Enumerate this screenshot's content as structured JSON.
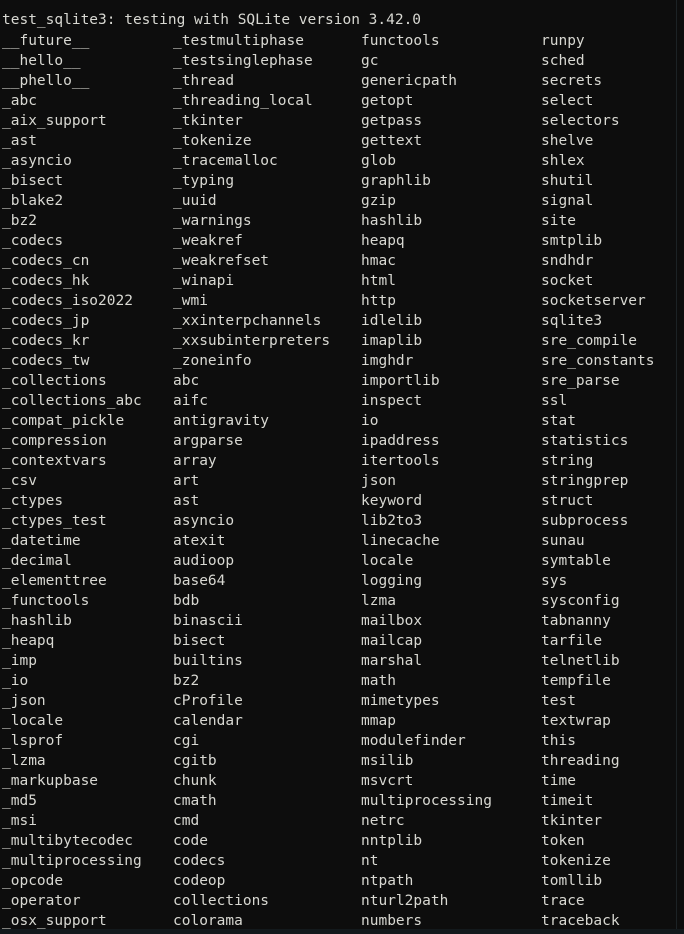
{
  "terminal": {
    "header_line": "test_sqlite3: testing with SQLite version 3.42.0",
    "background_color": "#0d0d0d",
    "text_color": "#d8d8d2",
    "divider_color": "#1c2225",
    "bottom_bar_color": "#13191c"
  },
  "module_columns": [
    {
      "name": "column-1",
      "items": [
        "__future__",
        "__hello__",
        "__phello__",
        "_abc",
        "_aix_support",
        "_ast",
        "_asyncio",
        "_bisect",
        "_blake2",
        "_bz2",
        "_codecs",
        "_codecs_cn",
        "_codecs_hk",
        "_codecs_iso2022",
        "_codecs_jp",
        "_codecs_kr",
        "_codecs_tw",
        "_collections",
        "_collections_abc",
        "_compat_pickle",
        "_compression",
        "_contextvars",
        "_csv",
        "_ctypes",
        "_ctypes_test",
        "_datetime",
        "_decimal",
        "_elementtree",
        "_functools",
        "_hashlib",
        "_heapq",
        "_imp",
        "_io",
        "_json",
        "_locale",
        "_lsprof",
        "_lzma",
        "_markupbase",
        "_md5",
        "_msi",
        "_multibytecodec",
        "_multiprocessing",
        "_opcode",
        "_operator",
        "_osx_support"
      ]
    },
    {
      "name": "column-2",
      "items": [
        "_testmultiphase",
        "_testsinglephase",
        "_thread",
        "_threading_local",
        "_tkinter",
        "_tokenize",
        "_tracemalloc",
        "_typing",
        "_uuid",
        "_warnings",
        "_weakref",
        "_weakrefset",
        "_winapi",
        "_wmi",
        "_xxinterpchannels",
        "_xxsubinterpreters",
        "_zoneinfo",
        "abc",
        "aifc",
        "antigravity",
        "argparse",
        "array",
        "art",
        "ast",
        "asyncio",
        "atexit",
        "audioop",
        "base64",
        "bdb",
        "binascii",
        "bisect",
        "builtins",
        "bz2",
        "cProfile",
        "calendar",
        "cgi",
        "cgitb",
        "chunk",
        "cmath",
        "cmd",
        "code",
        "codecs",
        "codeop",
        "collections",
        "colorama"
      ]
    },
    {
      "name": "column-3",
      "items": [
        "functools",
        "gc",
        "genericpath",
        "getopt",
        "getpass",
        "gettext",
        "glob",
        "graphlib",
        "gzip",
        "hashlib",
        "heapq",
        "hmac",
        "html",
        "http",
        "idlelib",
        "imaplib",
        "imghdr",
        "importlib",
        "inspect",
        "io",
        "ipaddress",
        "itertools",
        "json",
        "keyword",
        "lib2to3",
        "linecache",
        "locale",
        "logging",
        "lzma",
        "mailbox",
        "mailcap",
        "marshal",
        "math",
        "mimetypes",
        "mmap",
        "modulefinder",
        "msilib",
        "msvcrt",
        "multiprocessing",
        "netrc",
        "nntplib",
        "nt",
        "ntpath",
        "nturl2path",
        "numbers"
      ]
    },
    {
      "name": "column-4",
      "items": [
        "runpy",
        "sched",
        "secrets",
        "select",
        "selectors",
        "shelve",
        "shlex",
        "shutil",
        "signal",
        "site",
        "smtplib",
        "sndhdr",
        "socket",
        "socketserver",
        "sqlite3",
        "sre_compile",
        "sre_constants",
        "sre_parse",
        "ssl",
        "stat",
        "statistics",
        "string",
        "stringprep",
        "struct",
        "subprocess",
        "sunau",
        "symtable",
        "sys",
        "sysconfig",
        "tabnanny",
        "tarfile",
        "telnetlib",
        "tempfile",
        "test",
        "textwrap",
        "this",
        "threading",
        "time",
        "timeit",
        "tkinter",
        "token",
        "tokenize",
        "tomllib",
        "trace",
        "traceback"
      ]
    }
  ]
}
